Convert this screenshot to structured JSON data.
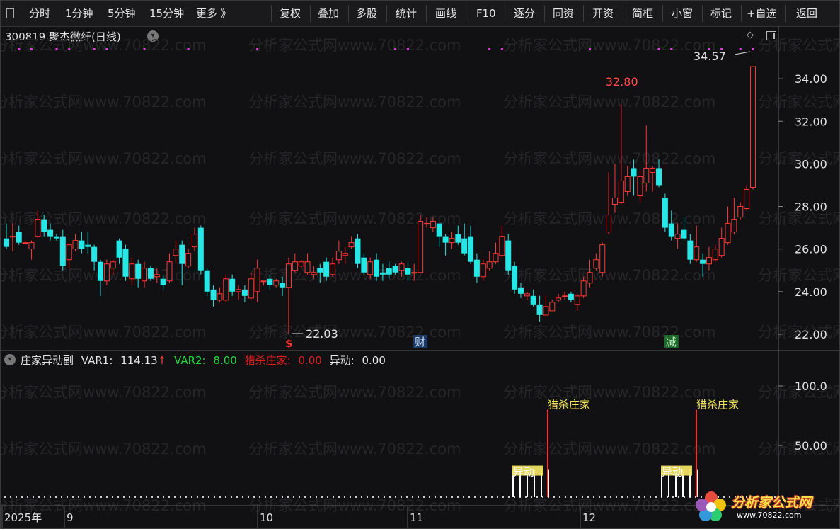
{
  "toolbar": {
    "items": [
      "分时",
      "1分钟",
      "5分钟",
      "15分钟",
      "更多 》",
      "复权",
      "叠加",
      "多股",
      "统计",
      "画线",
      "F10",
      "逐分",
      "同资",
      "开资",
      "简框",
      "小窗",
      "标记",
      "+自选",
      "返回"
    ]
  },
  "stock": {
    "code": "300819",
    "name": "聚杰微纤",
    "period": "(日线)"
  },
  "watermark": "分析家公式网www.70822.com",
  "colors": {
    "up": "#ff3838",
    "down": "#26e6e6",
    "bg": "#111114",
    "grid": "#3a3a3a",
    "label_red": "#ff4a4a",
    "yellow": "#f0e060"
  },
  "chart_data": {
    "type": "candlestick",
    "price_axis": {
      "ticks": [
        "34.00",
        "32.00",
        "30.00",
        "28.00",
        "26.00",
        "24.00",
        "22.00"
      ],
      "range": [
        21.3,
        35.6
      ]
    },
    "time_axis": {
      "labels": [
        "2025年",
        "9",
        "10",
        "11",
        "12"
      ]
    },
    "annotations": {
      "high_label": "32.80",
      "low_label": "22.03",
      "last_label": "34.57",
      "event_s": "$",
      "event_cai": "财",
      "event_jian": "减"
    },
    "candles": [
      [
        26.5,
        26.1,
        27.2,
        26.0
      ],
      [
        26.6,
        26.6,
        27.2,
        25.9
      ],
      [
        26.8,
        26.3,
        27.1,
        26.2
      ],
      [
        26.3,
        26.3,
        26.4,
        26.3
      ],
      [
        26.0,
        26.3,
        26.4,
        25.5
      ],
      [
        26.6,
        27.4,
        27.8,
        26.5
      ],
      [
        27.4,
        26.8,
        27.6,
        26.6
      ],
      [
        26.9,
        26.6,
        27.2,
        26.4
      ],
      [
        26.6,
        26.5,
        26.7,
        26.4
      ],
      [
        26.6,
        25.2,
        26.9,
        25.0
      ],
      [
        25.5,
        26.2,
        26.3,
        25.1
      ],
      [
        26.0,
        26.4,
        26.7,
        25.9
      ],
      [
        26.4,
        26.0,
        26.8,
        25.8
      ],
      [
        26.2,
        26.1,
        26.8,
        25.8
      ],
      [
        26.1,
        25.4,
        26.2,
        25.0
      ],
      [
        25.4,
        24.5,
        25.5,
        23.8
      ],
      [
        24.5,
        25.3,
        25.5,
        24.3
      ],
      [
        25.1,
        25.4,
        25.5,
        24.8
      ],
      [
        26.4,
        25.6,
        26.5,
        25.3
      ],
      [
        26.0,
        24.7,
        26.2,
        24.5
      ],
      [
        24.6,
        25.3,
        25.6,
        24.3
      ],
      [
        25.3,
        24.6,
        25.5,
        24.2
      ],
      [
        24.5,
        25.1,
        25.4,
        24.2
      ],
      [
        25.1,
        24.6,
        25.2,
        24.5
      ],
      [
        24.7,
        24.8,
        25.1,
        24.4
      ],
      [
        24.6,
        24.3,
        24.8,
        24.1
      ],
      [
        24.5,
        25.4,
        25.8,
        24.4
      ],
      [
        25.7,
        26.0,
        26.4,
        25.3
      ],
      [
        26.2,
        25.3,
        26.4,
        24.3
      ],
      [
        25.2,
        25.8,
        26.0,
        25.1
      ],
      [
        26.1,
        26.7,
        27.0,
        25.9
      ],
      [
        27.0,
        25.0,
        27.1,
        24.8
      ],
      [
        25.0,
        24.0,
        25.1,
        23.8
      ],
      [
        24.1,
        23.6,
        24.3,
        23.3
      ],
      [
        23.6,
        23.9,
        24.2,
        23.5
      ],
      [
        23.6,
        24.6,
        24.8,
        23.5
      ],
      [
        24.6,
        24.0,
        24.8,
        23.8
      ],
      [
        24.0,
        24.1,
        24.3,
        23.6
      ],
      [
        24.1,
        23.8,
        24.3,
        23.5
      ],
      [
        23.7,
        24.6,
        24.9,
        23.6
      ],
      [
        24.0,
        25.1,
        25.5,
        23.5
      ],
      [
        24.5,
        24.5,
        24.5,
        24.3
      ],
      [
        24.6,
        24.3,
        24.8,
        24.1
      ],
      [
        24.3,
        24.5,
        24.6,
        24.2
      ],
      [
        24.4,
        24.2,
        24.7,
        23.8
      ],
      [
        24.2,
        25.3,
        25.6,
        22.03
      ],
      [
        25.0,
        25.4,
        25.8,
        24.9
      ],
      [
        25.2,
        25.4,
        25.5,
        25.1
      ],
      [
        24.9,
        25.4,
        25.8,
        24.8
      ],
      [
        24.8,
        24.9,
        25.2,
        24.6
      ],
      [
        25.1,
        24.9,
        25.3,
        24.4
      ],
      [
        25.4,
        24.7,
        25.6,
        24.5
      ],
      [
        24.8,
        25.3,
        25.6,
        24.7
      ],
      [
        25.5,
        25.9,
        26.4,
        25.3
      ],
      [
        25.7,
        25.8,
        26.1,
        25.3
      ],
      [
        26.1,
        26.3,
        26.6,
        26.0
      ],
      [
        26.5,
        25.3,
        26.7,
        25.1
      ],
      [
        25.6,
        24.9,
        25.8,
        24.8
      ],
      [
        24.8,
        25.4,
        25.6,
        24.6
      ],
      [
        25.5,
        24.7,
        25.8,
        24.5
      ],
      [
        24.9,
        24.8,
        25.3,
        24.5
      ],
      [
        25.1,
        24.8,
        25.4,
        24.6
      ],
      [
        25.2,
        24.9,
        25.3,
        24.8
      ],
      [
        25.0,
        25.3,
        25.4,
        24.7
      ],
      [
        25.1,
        24.8,
        25.4,
        24.5
      ],
      [
        24.9,
        24.9,
        25.3,
        24.5
      ],
      [
        24.9,
        27.3,
        27.6,
        24.9
      ],
      [
        27.2,
        27.2,
        27.5,
        27.0
      ],
      [
        27.0,
        27.3,
        27.5,
        26.8
      ],
      [
        27.2,
        26.6,
        27.2,
        26.1
      ],
      [
        26.6,
        26.3,
        26.7,
        25.7
      ],
      [
        26.3,
        26.5,
        26.8,
        26.0
      ],
      [
        26.7,
        26.3,
        27.1,
        26.2
      ],
      [
        26.5,
        25.8,
        27.2,
        25.7
      ],
      [
        26.6,
        25.4,
        27.1,
        25.3
      ],
      [
        25.5,
        24.7,
        25.8,
        24.4
      ],
      [
        24.7,
        25.3,
        25.5,
        24.5
      ],
      [
        25.1,
        25.4,
        25.9,
        25.0
      ],
      [
        25.4,
        25.8,
        26.3,
        25.3
      ],
      [
        25.7,
        26.6,
        27.1,
        25.6
      ],
      [
        26.4,
        25.0,
        26.7,
        24.8
      ],
      [
        25.2,
        24.1,
        25.4,
        23.9
      ],
      [
        24.2,
        23.9,
        24.4,
        23.7
      ],
      [
        23.8,
        23.9,
        24.0,
        23.6
      ],
      [
        23.8,
        23.4,
        24.1,
        23.3
      ],
      [
        23.4,
        22.9,
        23.8,
        22.6
      ],
      [
        22.9,
        23.3,
        23.8,
        22.8
      ],
      [
        23.1,
        23.5,
        23.6,
        23.1
      ],
      [
        23.6,
        23.7,
        23.9,
        23.5
      ],
      [
        23.8,
        23.8,
        24.0,
        23.6
      ],
      [
        23.9,
        23.6,
        24.0,
        23.5
      ],
      [
        23.4,
        23.8,
        23.9,
        23.1
      ],
      [
        23.8,
        24.5,
        24.7,
        23.7
      ],
      [
        24.4,
        24.9,
        25.5,
        24.2
      ],
      [
        25.1,
        25.5,
        25.8,
        25.0
      ],
      [
        24.9,
        26.2,
        26.3,
        24.7
      ],
      [
        26.8,
        27.6,
        29.6,
        26.7
      ],
      [
        28.1,
        28.4,
        30.0,
        27.7
      ],
      [
        28.2,
        29.2,
        32.8,
        28.1
      ],
      [
        28.7,
        29.4,
        29.9,
        28.5
      ],
      [
        29.8,
        29.4,
        30.2,
        28.5
      ],
      [
        28.5,
        29.4,
        29.7,
        28.2
      ],
      [
        29.1,
        29.8,
        31.8,
        28.7
      ],
      [
        29.6,
        29.8,
        29.9,
        28.7
      ],
      [
        29.8,
        29.0,
        30.2,
        28.9
      ],
      [
        28.4,
        27.0,
        28.6,
        26.8
      ],
      [
        27.2,
        26.6,
        27.8,
        26.4
      ],
      [
        26.5,
        26.7,
        27.2,
        26.0
      ],
      [
        26.9,
        26.5,
        27.5,
        26.4
      ],
      [
        26.4,
        25.5,
        26.7,
        25.3
      ],
      [
        25.5,
        26.1,
        27.1,
        25.4
      ],
      [
        25.5,
        25.3,
        25.8,
        24.7
      ],
      [
        25.3,
        25.6,
        26.1,
        25.0
      ],
      [
        25.5,
        26.0,
        26.2,
        25.4
      ],
      [
        25.7,
        26.5,
        27.0,
        25.6
      ],
      [
        26.3,
        27.2,
        28.0,
        26.2
      ],
      [
        26.8,
        27.4,
        28.4,
        26.7
      ],
      [
        27.5,
        28.0,
        28.2,
        27.4
      ],
      [
        27.9,
        28.8,
        29.0,
        27.8
      ],
      [
        28.9,
        34.57,
        34.57,
        28.8
      ]
    ]
  },
  "indicator": {
    "name": "庄家异动副",
    "var1_label": "VAR1:",
    "var1_value": "114.13",
    "var1_arrow": "↑",
    "var2_label": "VAR2:",
    "var2_value": "8.00",
    "hunt_label": "猎杀庄家:",
    "hunt_value": "0.00",
    "move_label": "异动:",
    "move_value": "0.00",
    "axis_ticks": [
      "100.0",
      "50.00"
    ],
    "axis_range": [
      0,
      125
    ],
    "hunt_text": "猎杀庄家",
    "move_text": "异动"
  },
  "logo": {
    "text": "分析家公式网",
    "url": "www.70822.com"
  }
}
